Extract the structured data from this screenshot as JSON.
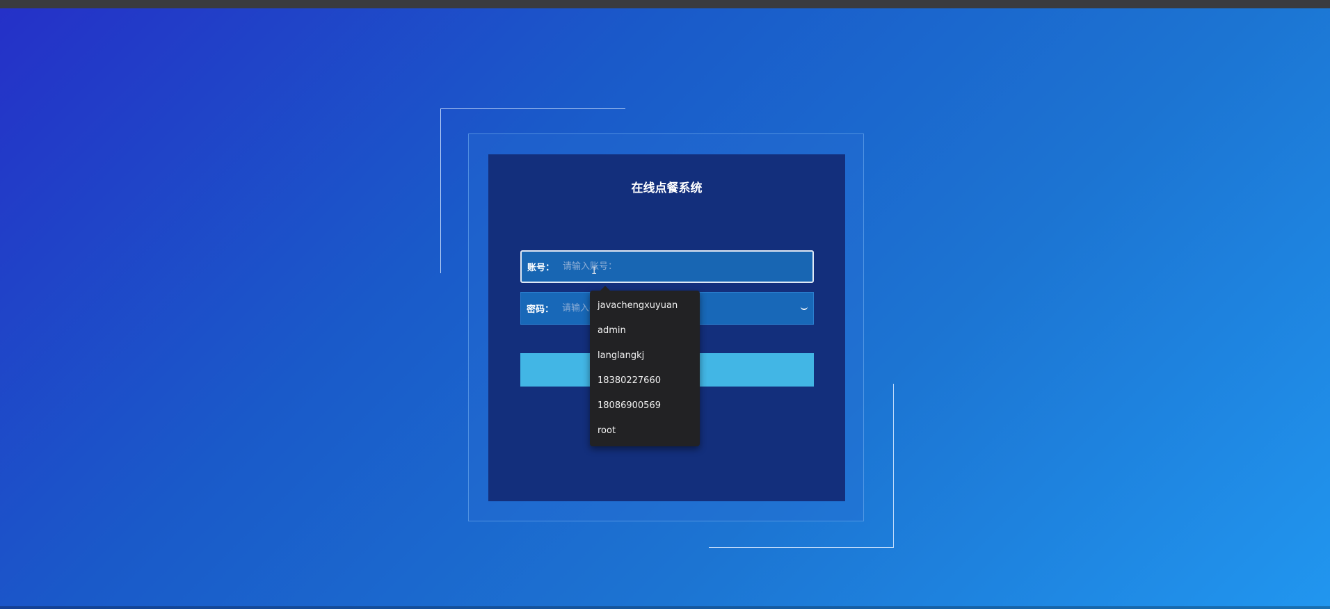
{
  "app": {
    "title": "在线点餐系统"
  },
  "login": {
    "account_label": "账号：",
    "account_placeholder": "请输入账号：",
    "account_value": "",
    "password_label": "密码：",
    "password_placeholder": "请输入密码：",
    "password_value": "",
    "submit_label": ""
  },
  "autocomplete": {
    "items": [
      "javachengxuyuan",
      "admin",
      "langlangkj",
      "18380227660",
      "18086900569",
      "root"
    ]
  },
  "icons": {
    "password_toggle": "eye-closed-icon",
    "cursor": "text-cursor-icon"
  },
  "colors": {
    "panel": "#132f7c",
    "field": "#1868b8",
    "button": "#42b6e5",
    "dropdown": "#222224"
  }
}
